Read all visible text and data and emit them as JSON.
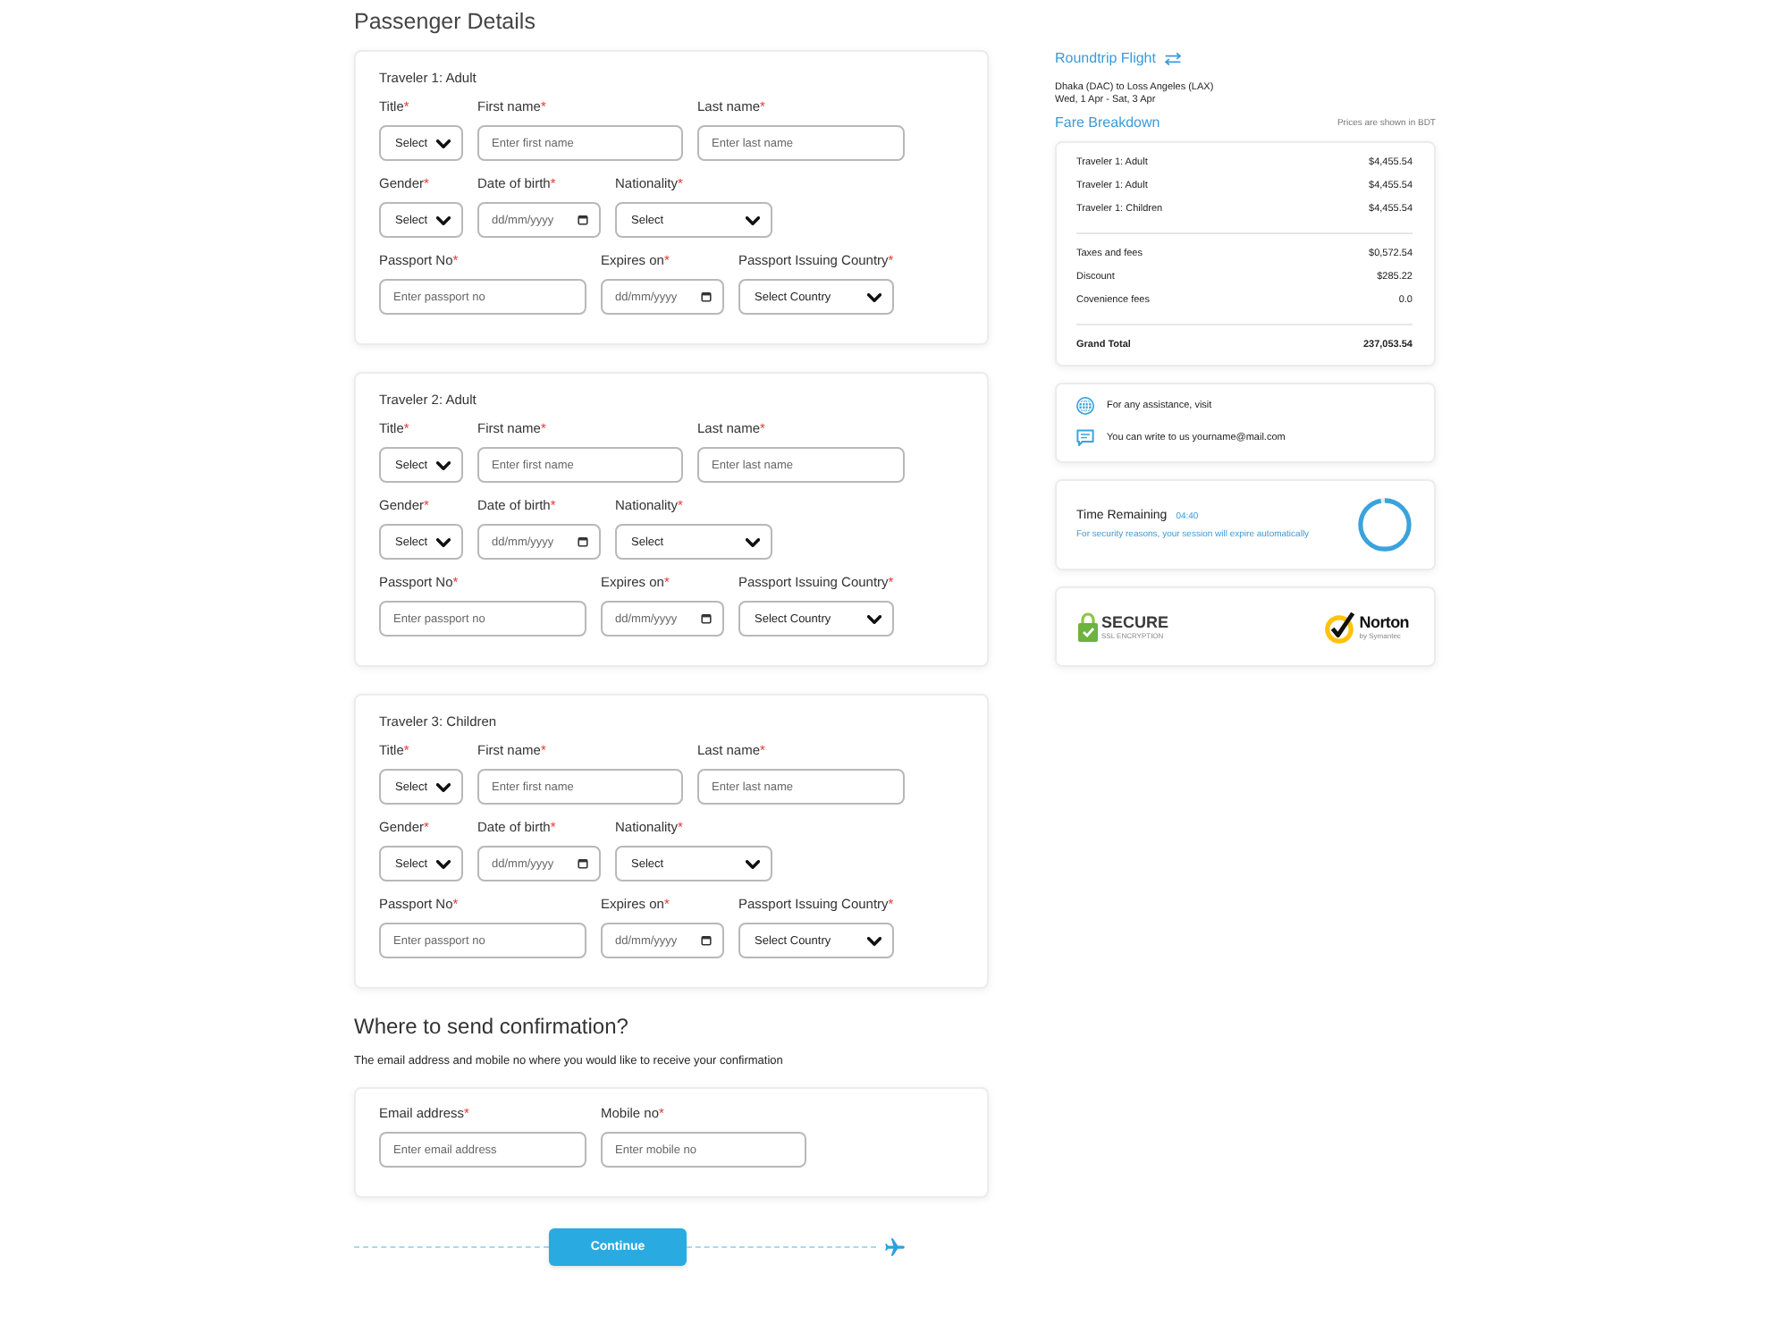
{
  "section_title": "Passenger Details",
  "travelers": [
    {
      "title": "Traveler 1: Adult",
      "rows": [
        [
          {
            "kind": "select",
            "label": "Title",
            "mark": "*",
            "value": "Select"
          },
          {
            "kind": "text",
            "label": "First name",
            "mark": "*",
            "placeholder": "Enter first name"
          },
          {
            "kind": "text",
            "label": "Last name",
            "mark": "*",
            "placeholder": "Enter last name"
          }
        ],
        [
          {
            "kind": "select",
            "label": "Gender",
            "mark": "*",
            "value": "Select"
          },
          {
            "kind": "date",
            "label": "Date of birth",
            "mark": "*",
            "placeholder": "dd/mm/yyyy"
          },
          {
            "kind": "select",
            "label": "Nationality",
            "mark": "*",
            "value": "Select"
          }
        ],
        [
          {
            "kind": "text",
            "label": "Passport No",
            "mark": "*",
            "placeholder": "Enter passport no"
          },
          {
            "kind": "date",
            "label": "Expires on",
            "mark": "*",
            "placeholder": "dd/mm/yyyy"
          },
          {
            "kind": "select",
            "label": "Passport Issuing Country",
            "mark": "*",
            "value": "Select Country"
          }
        ]
      ]
    },
    {
      "title": "Traveler 2: Adult",
      "rows": [
        [
          {
            "kind": "select",
            "label": "Title",
            "mark": "*",
            "value": "Select"
          },
          {
            "kind": "text",
            "label": "First name",
            "mark": "*",
            "placeholder": "Enter first name"
          },
          {
            "kind": "text",
            "label": "Last name",
            "mark": "*",
            "placeholder": "Enter last name"
          }
        ],
        [
          {
            "kind": "select",
            "label": "Gender",
            "mark": "*",
            "value": "Select"
          },
          {
            "kind": "date",
            "label": "Date of birth",
            "mark": "*",
            "placeholder": "dd/mm/yyyy"
          },
          {
            "kind": "select",
            "label": "Nationality",
            "mark": "*",
            "value": "Select"
          }
        ],
        [
          {
            "kind": "text",
            "label": "Passport No",
            "mark": "*",
            "placeholder": "Enter passport no"
          },
          {
            "kind": "date",
            "label": "Expires on",
            "mark": "*",
            "placeholder": "dd/mm/yyyy"
          },
          {
            "kind": "select",
            "label": "Passport Issuing Country",
            "mark": "*",
            "value": "Select Country"
          }
        ]
      ]
    },
    {
      "title": "Traveler 3: Children",
      "rows": [
        [
          {
            "kind": "select",
            "label": "Title",
            "mark": "*",
            "value": "Select"
          },
          {
            "kind": "text",
            "label": "First name",
            "mark": "*",
            "placeholder": "Enter first name"
          },
          {
            "kind": "text",
            "label": "Last name",
            "mark": "*",
            "placeholder": "Enter last name"
          }
        ],
        [
          {
            "kind": "select",
            "label": "Gender",
            "mark": "*",
            "value": "Select"
          },
          {
            "kind": "date",
            "label": "Date of birth",
            "mark": "*",
            "placeholder": "dd/mm/yyyy"
          },
          {
            "kind": "select",
            "label": "Nationality",
            "mark": "*",
            "value": "Select"
          }
        ],
        [
          {
            "kind": "text",
            "label": "Passport No",
            "mark": "*",
            "placeholder": "Enter passport no"
          },
          {
            "kind": "date",
            "label": "Expires on",
            "mark": "*",
            "placeholder": "dd/mm/yyyy"
          },
          {
            "kind": "select",
            "label": "Passport Issuing Country",
            "mark": "*",
            "value": "Select Country"
          }
        ]
      ]
    }
  ],
  "confirmation": {
    "title": "Where to send confirmation?",
    "subtitle": "The email address and mobile no where you would like to receive your confirmation",
    "fields": [
      {
        "kind": "text",
        "label": "Email address",
        "mark": "*",
        "placeholder": "Enter email address"
      },
      {
        "kind": "text",
        "label": "Mobile no",
        "mark": "*",
        "placeholder": "Enter mobile no"
      }
    ]
  },
  "continue_button": "Continue",
  "summary": {
    "trip_type": "Roundtrip Flight",
    "route": "Dhaka (DAC) to Loss Angeles (LAX)",
    "dates": "Wed, 1 Apr - Sat, 3 Apr",
    "fare_title": "Fare Breakdown",
    "currency_note": "Prices are shown in BDT",
    "fare_groups": [
      {
        "kind": "travelers",
        "rows": [
          {
            "label": "Traveler 1: Adult",
            "amount": "$4,455.54"
          },
          {
            "label": "Traveler 1: Adult",
            "amount": "$4,455.54"
          },
          {
            "label": "Traveler 1: Children",
            "amount": "$4,455.54"
          }
        ]
      },
      {
        "kind": "charges",
        "rows": [
          {
            "label": "Taxes and fees",
            "amount": "$0,572.54"
          },
          {
            "label": "Discount",
            "amount": "$285.22"
          },
          {
            "label": "Covenience fees",
            "amount": "0.0"
          }
        ]
      },
      {
        "kind": "total",
        "rows": [
          {
            "label": "Grand Total",
            "amount": "237,053.54"
          }
        ]
      }
    ]
  },
  "assistance": [
    {
      "kind": "web",
      "text": "For any assistance, visit"
    },
    {
      "kind": "chat",
      "text": "You can write to us yourname@mail.com"
    }
  ],
  "timer": {
    "label": "Time Remaining",
    "time": "04:40",
    "note": "For security reasons, your session will expire automatically",
    "level": 0.97
  },
  "badges": [
    {
      "kind": "secure",
      "title": "SECURE",
      "caption": "SSL ENCRYPTION"
    },
    {
      "kind": "norton",
      "title": "Norton",
      "caption": "by Symantec"
    }
  ]
}
